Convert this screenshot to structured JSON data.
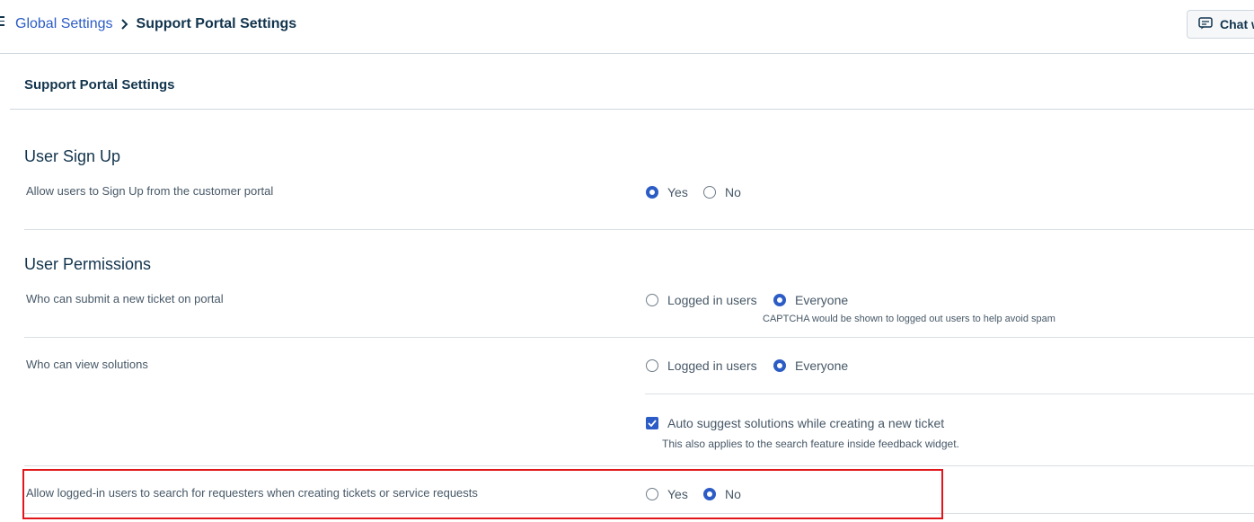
{
  "header": {
    "breadcrumb_parent": "Global Settings",
    "breadcrumb_current": "Support Portal Settings",
    "chat_button_label": "Chat w"
  },
  "panel": {
    "title": "Support Portal Settings"
  },
  "sections": {
    "signup": {
      "title": "User Sign Up",
      "row_label": "Allow users to Sign Up from the customer portal",
      "options": [
        "Yes",
        "No"
      ],
      "selected": "Yes"
    },
    "permissions": {
      "title": "User Permissions",
      "submit_ticket": {
        "label": "Who can submit a new ticket on portal",
        "options": [
          "Logged in users",
          "Everyone"
        ],
        "selected": "Everyone",
        "hint": "CAPTCHA would be shown to logged out users to help avoid spam"
      },
      "view_solutions": {
        "label": "Who can view solutions",
        "options": [
          "Logged in users",
          "Everyone"
        ],
        "selected": "Everyone"
      },
      "auto_suggest": {
        "label": "Auto suggest solutions while creating a new ticket",
        "checked": true,
        "hint": "This also applies to the search feature inside feedback widget."
      },
      "search_requesters": {
        "label": "Allow logged-in users to search for requesters when creating tickets or service requests",
        "options": [
          "Yes",
          "No"
        ],
        "selected": "No"
      }
    }
  },
  "colors": {
    "accent": "#2c5cc5",
    "highlight_border": "#e0161a"
  }
}
